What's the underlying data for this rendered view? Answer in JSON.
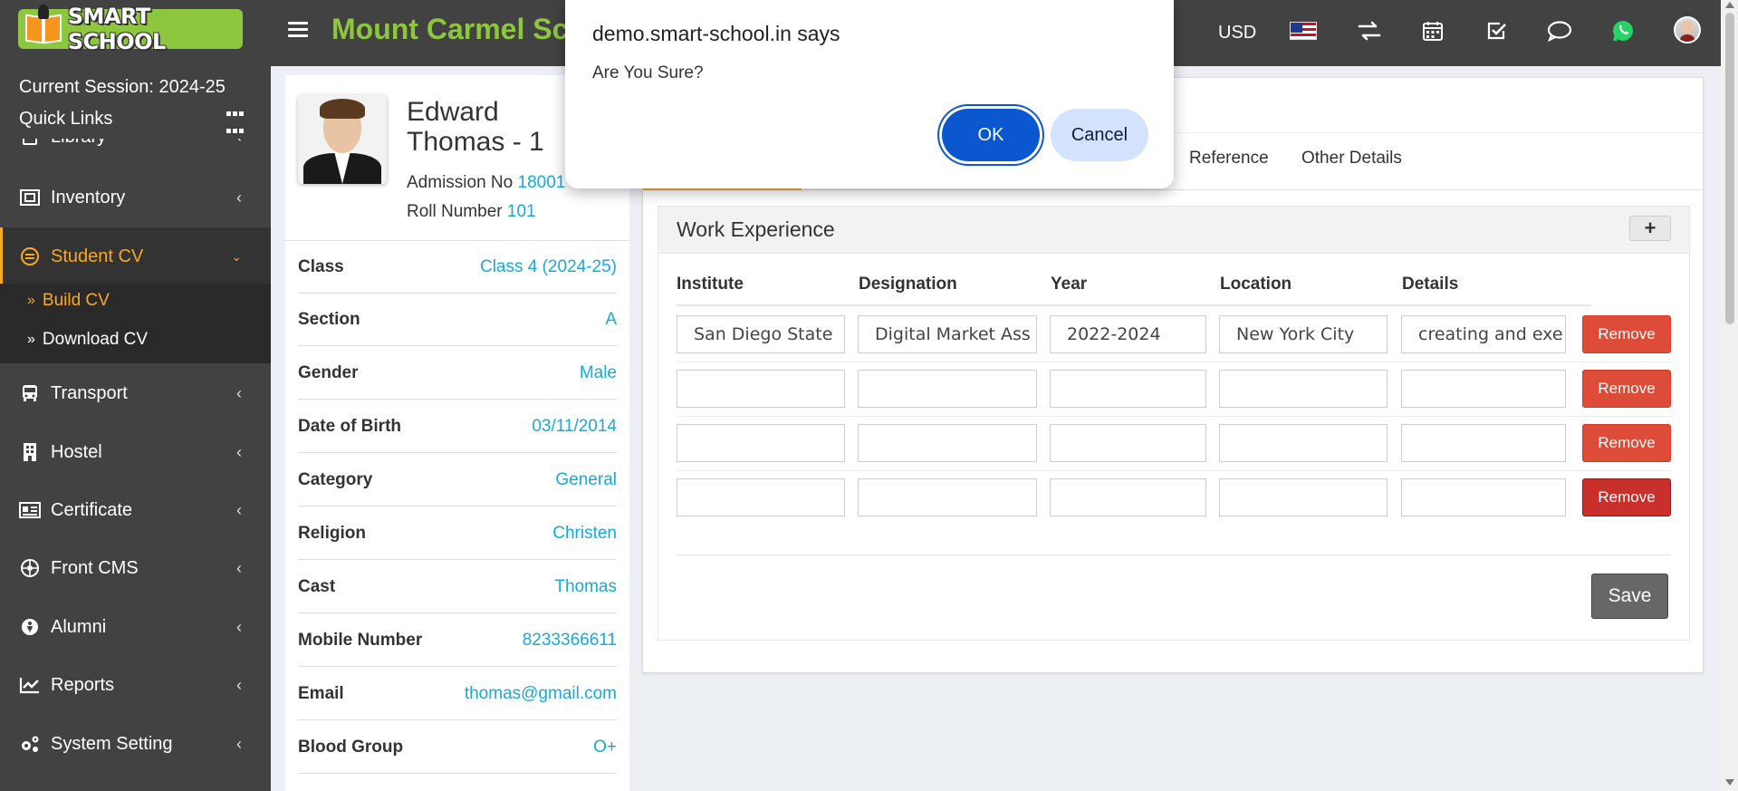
{
  "header": {
    "logo_text": "SMART SCHOOL",
    "school_name": "Mount Carmel School",
    "currency": "USD",
    "icons": [
      "menu-icon",
      "flag-icon",
      "exchange-icon",
      "calendar-icon",
      "checkbox-icon",
      "chat-icon",
      "whatsapp-icon",
      "user-avatar"
    ]
  },
  "sidebar": {
    "session": "Current Session: 2024-25",
    "quick_links": "Quick Links",
    "items": [
      {
        "label": "Library",
        "icon": "book-icon"
      },
      {
        "label": "Inventory",
        "icon": "inventory-icon"
      },
      {
        "label": "Student CV",
        "icon": "cv-icon"
      },
      {
        "label": "Transport",
        "icon": "bus-icon"
      },
      {
        "label": "Hostel",
        "icon": "building-icon"
      },
      {
        "label": "Certificate",
        "icon": "certificate-icon"
      },
      {
        "label": "Front CMS",
        "icon": "cms-icon"
      },
      {
        "label": "Alumni",
        "icon": "alumni-icon"
      },
      {
        "label": "Reports",
        "icon": "chart-icon"
      },
      {
        "label": "System Setting",
        "icon": "gears-icon"
      }
    ],
    "submenu": [
      "Build CV",
      "Download CV"
    ]
  },
  "profile": {
    "name": "Edward Thomas - 1",
    "admission_label": "Admission No",
    "admission_no": "18001",
    "roll_label": "Roll Number",
    "roll_no": "101",
    "fields": [
      {
        "k": "Class",
        "v": "Class 4 (2024-25)"
      },
      {
        "k": "Section",
        "v": "A"
      },
      {
        "k": "Gender",
        "v": "Male"
      },
      {
        "k": "Date of Birth",
        "v": "03/11/2014"
      },
      {
        "k": "Category",
        "v": "General"
      },
      {
        "k": "Religion",
        "v": "Christen"
      },
      {
        "k": "Cast",
        "v": "Thomas"
      },
      {
        "k": "Mobile Number",
        "v": "8233366611"
      },
      {
        "k": "Email",
        "v": "thomas@gmail.com"
      },
      {
        "k": "Blood Group",
        "v": "O+"
      }
    ]
  },
  "tabs": [
    "Reference",
    "Other Details"
  ],
  "work_experience": {
    "title": "Work Experience",
    "add_label": "+",
    "headers": [
      "Institute",
      "Designation",
      "Year",
      "Location",
      "Details"
    ],
    "rows": [
      [
        "San Diego State",
        "Digital Market Ass",
        "2022-2024",
        "New York City",
        "creating and exe"
      ],
      [
        "",
        "",
        "",
        "",
        ""
      ],
      [
        "",
        "",
        "",
        "",
        ""
      ],
      [
        "",
        "",
        "",
        "",
        ""
      ]
    ],
    "remove_label": "Remove",
    "save_label": "Save"
  },
  "dialog": {
    "title": "demo.smart-school.in says",
    "message": "Are You Sure?",
    "ok": "OK",
    "cancel": "Cancel"
  },
  "colors": {
    "header_bg": "#424242",
    "brand_green": "#8dc63f",
    "accent_orange": "#f9a825",
    "link_blue": "#17a9d8",
    "remove_red": "#dd4b39",
    "dialog_blue": "#0b57d0"
  }
}
